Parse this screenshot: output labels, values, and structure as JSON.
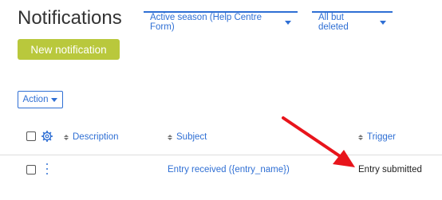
{
  "page": {
    "title": "Notifications"
  },
  "filters": {
    "season": {
      "label": "Active season (Help Centre Form)",
      "icon": "chevron-down-icon"
    },
    "status": {
      "label": "All but deleted",
      "icon": "chevron-down-icon"
    }
  },
  "toolbar": {
    "new_notification_label": "New notification",
    "action_label": "Action"
  },
  "table": {
    "columns": [
      {
        "label": "Description"
      },
      {
        "label": "Subject"
      },
      {
        "label": "Trigger"
      }
    ],
    "rows": [
      {
        "description": "",
        "subject": "Entry received ({entry_name})",
        "trigger": "Entry submitted"
      }
    ]
  },
  "annotation": {
    "arrow_color": "#e8141b"
  },
  "colors": {
    "accent": "#2f6fd4",
    "primary_button": "#b9c83c"
  }
}
